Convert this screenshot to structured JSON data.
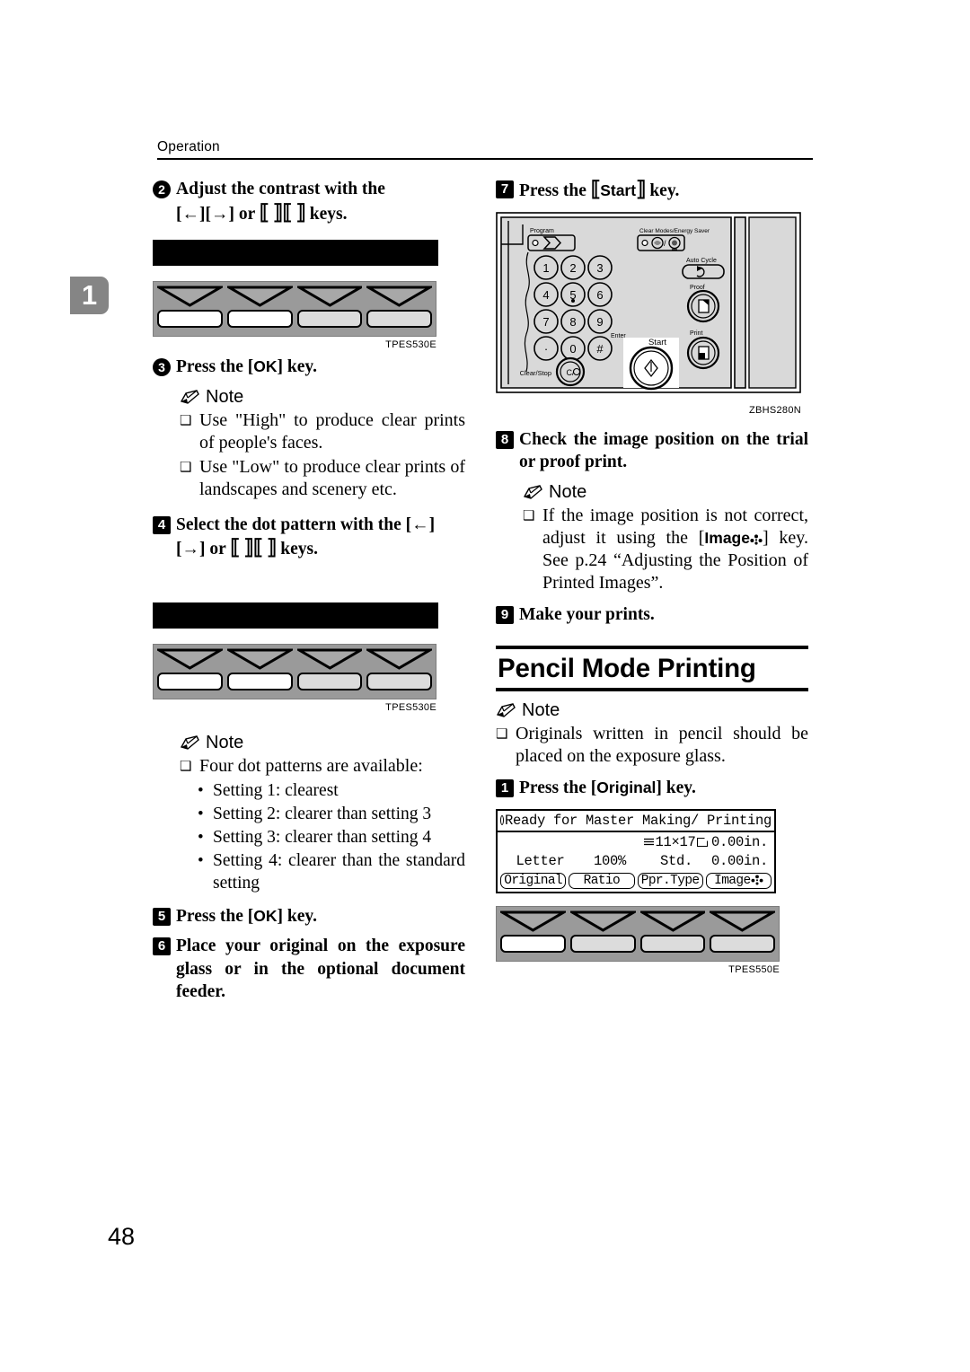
{
  "page": {
    "running_head": "Operation",
    "chapter_tab": "1",
    "page_number": "48"
  },
  "left_column": {
    "step2": {
      "badge": "2",
      "line1": "Adjust  the  contrast  with  the",
      "line2_pre": "[",
      "arrow_left": "←",
      "line2_mid": "][",
      "arrow_right": "→",
      "line2_post": "] or",
      "line2_end": "keys."
    },
    "figure1": {
      "code": "TPES530E",
      "keys": [
        "white",
        "white",
        "gray",
        "gray"
      ]
    },
    "step3": {
      "badge": "3",
      "text_pre": "Press the [",
      "key": "OK",
      "text_post": "] key."
    },
    "note1": {
      "title": "Note",
      "items": [
        "Use \"High\" to produce clear prints of people's faces.",
        "Use \"Low\" to produce clear prints of landscapes and scenery etc."
      ]
    },
    "step4": {
      "badge": "4",
      "line1_a": "Select the dot pattern with the [",
      "arrow_left": "←",
      "line1_b": "]",
      "line2_a": "[",
      "arrow_right": "→",
      "line2_b": "] or",
      "line2_end": "keys."
    },
    "figure2": {
      "code": "TPES530E",
      "keys": [
        "white",
        "white",
        "gray",
        "gray"
      ]
    },
    "note2": {
      "title": "Note",
      "item": "Four dot patterns are available:",
      "sub_items": [
        "Setting 1: clearest",
        "Setting 2: clearer than setting 3",
        "Setting 3: clearer than setting 4",
        "Setting 4: clearer than the standard setting"
      ]
    },
    "step5": {
      "badge": "5",
      "text_pre": "Press the [",
      "key": "OK",
      "text_post": "] key."
    },
    "step6": {
      "badge": "6",
      "text": "Place your original on the exposure glass or in the optional document feeder."
    }
  },
  "right_column": {
    "step7": {
      "badge": "7",
      "text_pre": "Press the",
      "key": "Start",
      "text_post": "key."
    },
    "panel_figure": {
      "code": "ZBHS280N",
      "labels": {
        "program": "Program",
        "clear_modes": "Clear Modes/Energy Saver",
        "auto_cycle": "Auto Cycle",
        "proof": "Proof",
        "print": "Print",
        "enter": "Enter",
        "start": "Start",
        "clear_stop": "Clear/Stop"
      },
      "keypad": [
        "1",
        "2",
        "3",
        "4",
        "5",
        "6",
        "7",
        "8",
        "9",
        "·",
        "0",
        "#"
      ]
    },
    "step8": {
      "badge": "8",
      "text": "Check the image position on the trial or proof print."
    },
    "note3": {
      "title": "Note",
      "item_a": "If the image position is not correct, adjust it using the [",
      "item_key": "Image",
      "item_b": "] key. See p.24 “Adjusting the Position of Printed Images”."
    },
    "step9": {
      "badge": "9",
      "text": "Make your prints."
    },
    "section_heading": "Pencil Mode Printing",
    "note4": {
      "title": "Note",
      "item": "Originals written in pencil should be placed on the exposure glass."
    },
    "stepA": {
      "badge": "1",
      "text_pre": "Press the [",
      "key": "Original",
      "text_post": "] key."
    },
    "lcd": {
      "status": "Ready for Master Making/ Printing",
      "row1": {
        "c1": "",
        "c2": "",
        "c3": "11×17",
        "c4": "0.00in."
      },
      "row2": {
        "c1": "Letter",
        "c2": "100%",
        "c3": "Std.",
        "c4": "0.00in."
      },
      "softkeys": [
        "Original",
        "Ratio",
        "Ppr.Type",
        "Image"
      ]
    },
    "figure3": {
      "code": "TPES550E",
      "keys": [
        "white",
        "gray",
        "gray",
        "gray"
      ]
    }
  }
}
